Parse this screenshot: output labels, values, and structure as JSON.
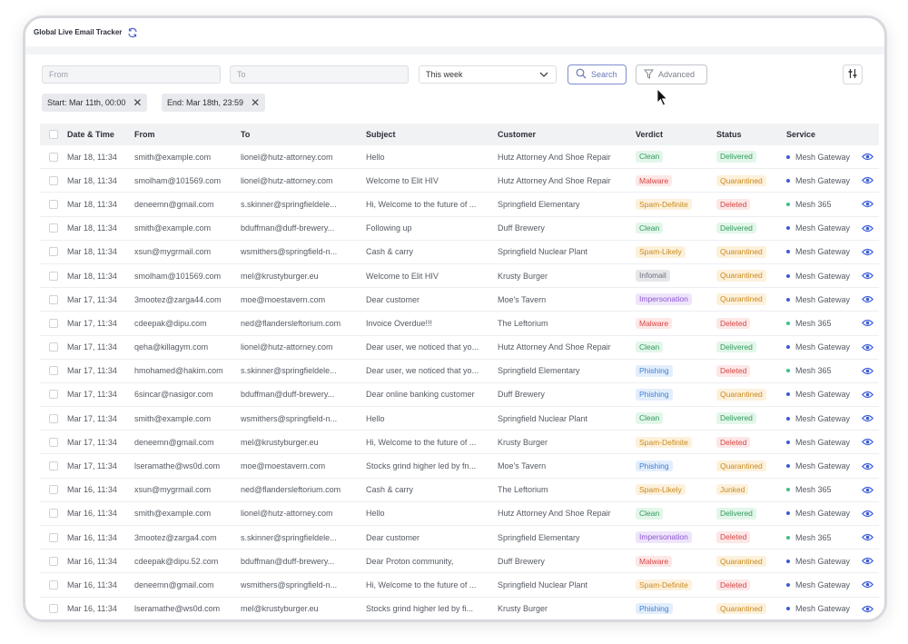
{
  "app": {
    "title": "Global Live Email Tracker"
  },
  "filters": {
    "from_placeholder": "From",
    "to_placeholder": "To",
    "period_value": "This week",
    "search_label": "Search",
    "advanced_label": "Advanced",
    "chips": [
      {
        "label": "Start: Mar 11th, 00:00"
      },
      {
        "label": "End:  Mar 18th, 23:59"
      }
    ]
  },
  "columns": {
    "date": "Date & Time",
    "from": "From",
    "to": "To",
    "subject": "Subject",
    "customer": "Customer",
    "verdict": "Verdict",
    "status": "Status",
    "service": "Service"
  },
  "colors": {
    "Clean": {
      "bg": "#e3f6ea",
      "fg": "#2f9a5b"
    },
    "Malware": {
      "bg": "#fde7e7",
      "fg": "#d64545"
    },
    "Spam-Definite": {
      "bg": "#fdf1dc",
      "fg": "#c98a1e"
    },
    "Spam-Likely": {
      "bg": "#fdf1dc",
      "fg": "#c98a1e"
    },
    "Infomail": {
      "bg": "#e6e7ea",
      "fg": "#6d7280"
    },
    "Impersonation": {
      "bg": "#efe5fb",
      "fg": "#8e54d6"
    },
    "Phishing": {
      "bg": "#e3eefc",
      "fg": "#3f7fd8"
    },
    "Delivered": {
      "bg": "#e3f6ea",
      "fg": "#2f9a5b"
    },
    "Quarantined": {
      "bg": "#fdf1dc",
      "fg": "#c98a1e"
    },
    "Deleted": {
      "bg": "#fde7e7",
      "fg": "#d64545"
    },
    "Junked": {
      "bg": "#fdf1dc",
      "fg": "#c98a1e"
    },
    "Mesh Gateway": {
      "dot": "#3c5bd6"
    },
    "Mesh 365": {
      "dot": "#3fbf7f"
    }
  },
  "rows": [
    {
      "date": "Mar 18, 11:34",
      "from": "smith@example.com",
      "to": "lionel@hutz-attorney.com",
      "subject": "Hello",
      "customer": "Hutz Attorney And Shoe Repair",
      "verdict": "Clean",
      "status": "Delivered",
      "service": "Mesh Gateway"
    },
    {
      "date": "Mar 18, 11:34",
      "from": "smolham@101569.com",
      "to": "lionel@hutz-attorney.com",
      "subject": "Welcome to Elit HIV",
      "customer": "Hutz Attorney And Shoe Repair",
      "verdict": "Malware",
      "status": "Quarantined",
      "service": "Mesh Gateway"
    },
    {
      "date": "Mar 18, 11:34",
      "from": "deneemn@gmail.com",
      "to": "s.skinner@springfieldele...",
      "subject": "Hi, Welcome to the future of ...",
      "customer": "Springfield Elementary",
      "verdict": "Spam-Definite",
      "status": "Deleted",
      "service": "Mesh 365"
    },
    {
      "date": "Mar 18, 11:34",
      "from": "smith@example.com",
      "to": "bduffman@duff-brewery...",
      "subject": "Following up",
      "customer": "Duff Brewery",
      "verdict": "Clean",
      "status": "Delivered",
      "service": "Mesh Gateway"
    },
    {
      "date": "Mar 18, 11:34",
      "from": "xsun@mygrmail.com",
      "to": "wsmithers@springfield-n...",
      "subject": "Cash & carry",
      "customer": "Springfield Nuclear Plant",
      "verdict": "Spam-Likely",
      "status": "Quarantined",
      "service": "Mesh Gateway"
    },
    {
      "date": "Mar 18, 11:34",
      "from": "smolham@101569.com",
      "to": "mel@krustyburger.eu",
      "subject": "Welcome to Elit HIV",
      "customer": "Krusty Burger",
      "verdict": "Infomail",
      "status": "Quarantined",
      "service": "Mesh Gateway"
    },
    {
      "date": "Mar 17, 11:34",
      "from": "3mootez@zarga44.com",
      "to": "moe@moestavern.com",
      "subject": "Dear customer",
      "customer": "Moe's Tavern",
      "verdict": "Impersonation",
      "status": "Quarantined",
      "service": "Mesh Gateway"
    },
    {
      "date": "Mar 17, 11:34",
      "from": "cdeepak@dipu.com",
      "to": "ned@flandersleftorium.com",
      "subject": "Invoice Overdue!!!",
      "customer": "The Leftorium",
      "verdict": "Malware",
      "status": "Deleted",
      "service": "Mesh 365"
    },
    {
      "date": "Mar 17, 11:34",
      "from": "qeha@killagym.com",
      "to": "lionel@hutz-attorney.com",
      "subject": "Dear user, we noticed that yo...",
      "customer": "Hutz Attorney And Shoe Repair",
      "verdict": "Clean",
      "status": "Delivered",
      "service": "Mesh Gateway"
    },
    {
      "date": "Mar 17, 11:34",
      "from": "hmohamed@hakim.com",
      "to": "s.skinner@springfieldele...",
      "subject": "Dear user, we noticed that yo...",
      "customer": "Springfield Elementary",
      "verdict": "Phishing",
      "status": "Deleted",
      "service": "Mesh 365"
    },
    {
      "date": "Mar 17, 11:34",
      "from": "6sincar@nasigor.com",
      "to": "bduffman@duff-brewery...",
      "subject": "Dear online banking customer",
      "customer": "Duff Brewery",
      "verdict": "Phishing",
      "status": "Quarantined",
      "service": "Mesh Gateway"
    },
    {
      "date": "Mar 17, 11:34",
      "from": "smith@example.com",
      "to": "wsmithers@springfield-n...",
      "subject": "Hello",
      "customer": "Springfield Nuclear Plant",
      "verdict": "Clean",
      "status": "Delivered",
      "service": "Mesh Gateway"
    },
    {
      "date": "Mar 17, 11:34",
      "from": "deneemn@gmail.com",
      "to": "mel@krustyburger.eu",
      "subject": "Hi, Welcome to the future of ...",
      "customer": "Krusty Burger",
      "verdict": "Spam-Definite",
      "status": "Deleted",
      "service": "Mesh Gateway"
    },
    {
      "date": "Mar 17, 11:34",
      "from": "lseramathe@ws0d.com",
      "to": "moe@moestavern.com",
      "subject": "Stocks grind higher led by fn...",
      "customer": "Moe's Tavern",
      "verdict": "Phishing",
      "status": "Quarantined",
      "service": "Mesh Gateway"
    },
    {
      "date": "Mar 16, 11:34",
      "from": "xsun@mygrmail.com",
      "to": "ned@flandersleftorium.com",
      "subject": "Cash & carry",
      "customer": "The Leftorium",
      "verdict": "Spam-Likely",
      "status": "Junked",
      "service": "Mesh 365"
    },
    {
      "date": "Mar 16, 11:34",
      "from": "smith@example.com",
      "to": "lionel@hutz-attorney.com",
      "subject": "Hello",
      "customer": "Hutz Attorney And Shoe Repair",
      "verdict": "Clean",
      "status": "Delivered",
      "service": "Mesh Gateway"
    },
    {
      "date": "Mar 16, 11:34",
      "from": "3mootez@zarga4.com",
      "to": "s.skinner@springfieldele...",
      "subject": "Dear customer",
      "customer": "Springfield Elementary",
      "verdict": "Impersonation",
      "status": "Deleted",
      "service": "Mesh 365"
    },
    {
      "date": "Mar 16, 11:34",
      "from": "cdeepak@dipu.52.com",
      "to": "bduffman@duff-brewery...",
      "subject": "Dear Proton community,",
      "customer": "Duff Brewery",
      "verdict": "Malware",
      "status": "Quarantined",
      "service": "Mesh Gateway"
    },
    {
      "date": "Mar 16, 11:34",
      "from": "deneemn@gmail.com",
      "to": "wsmithers@springfield-n...",
      "subject": "Hi, Welcome to the future of ...",
      "customer": "Springfield Nuclear Plant",
      "verdict": "Spam-Definite",
      "status": "Deleted",
      "service": "Mesh Gateway"
    },
    {
      "date": "Mar 16, 11:34",
      "from": "lseramathe@ws0d.com",
      "to": "mel@krustyburger.eu",
      "subject": "Stocks grind higher led by fi...",
      "customer": "Krusty Burger",
      "verdict": "Phishing",
      "status": "Quarantined",
      "service": "Mesh Gateway"
    }
  ]
}
